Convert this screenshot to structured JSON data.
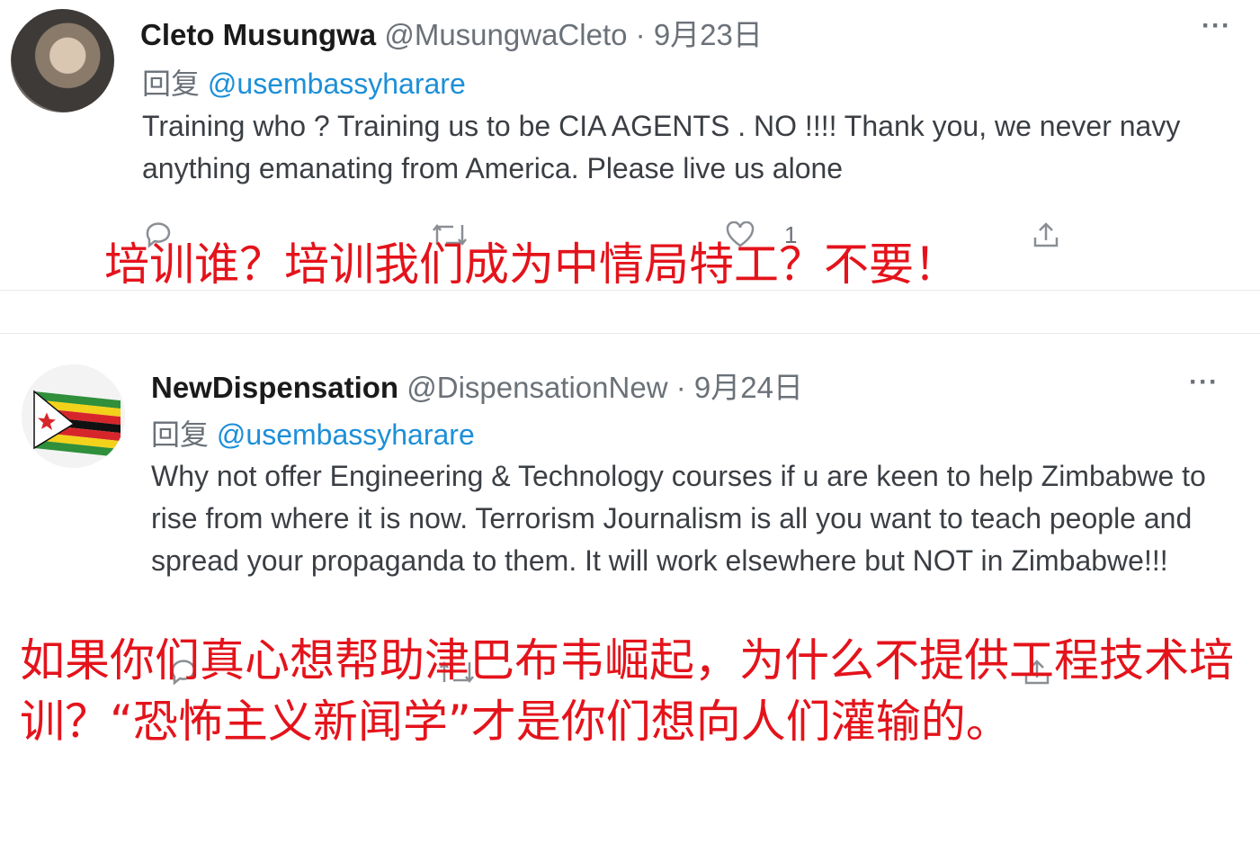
{
  "tweets": [
    {
      "name": "Cleto Musungwa",
      "handle": "@MusungwaCleto",
      "separator": "·",
      "date": "9月23日",
      "more": "···",
      "reply_prefix": "回复",
      "reply_to": "@usembassyharare",
      "text": "Training who ? Training us to be CIA AGENTS . NO !!!! Thank you, we never navy anything emanating from America. Please live us alone",
      "like_count": "1",
      "caption": "培训谁？培训我们成为中情局特工？不要！"
    },
    {
      "name": "NewDispensation",
      "handle": "@DispensationNew",
      "separator": "·",
      "date": "9月24日",
      "more": "···",
      "reply_prefix": "回复",
      "reply_to": "@usembassyharare",
      "text": "Why not offer Engineering & Technology courses if u are keen to help Zimbabwe to rise from where it is now. Terrorism Journalism is all you want to teach people and spread your propaganda to them. It will work elsewhere but NOT in Zimbabwe!!!",
      "caption": "如果你们真心想帮助津巴布韦崛起，为什么不提供工程技术培训？“恐怖主义新闻学”才是你们想向人们灌输的。"
    }
  ],
  "icons": {
    "reply": "reply-icon",
    "retweet": "retweet-icon",
    "like": "like-icon",
    "share": "share-icon",
    "flag": "zimbabwe-flag-icon"
  },
  "colors": {
    "mention": "#1d8fd8",
    "caption": "#e4131b",
    "muted": "#6b7178"
  }
}
